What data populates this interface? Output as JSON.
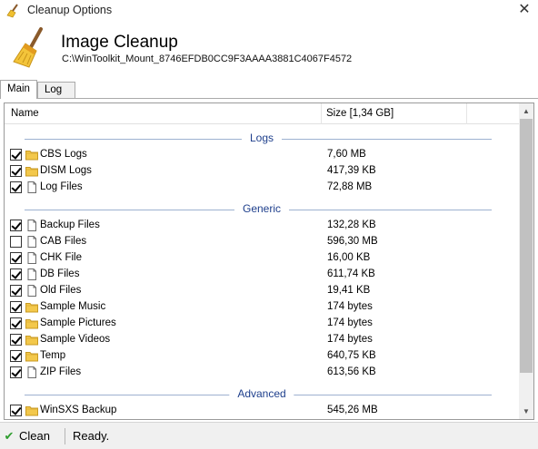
{
  "window": {
    "title": "Cleanup Options",
    "close_glyph": "✕",
    "app_icon": "broom-icon"
  },
  "header": {
    "title": "Image Cleanup",
    "path": "C:\\WinToolkit_Mount_8746EFDB0CC9F3AAAA3881C4067F4572",
    "icon": "broom-icon"
  },
  "tabs": [
    {
      "label": "Main",
      "active": true
    },
    {
      "label": "Log",
      "active": false
    }
  ],
  "columns": {
    "name": "Name",
    "size": "Size [1,34 GB]"
  },
  "groups": [
    {
      "label": "Logs"
    },
    {
      "label": "Generic"
    },
    {
      "label": "Advanced"
    }
  ],
  "rows": [
    {
      "checked": true,
      "icon": "folder-icon",
      "name": "CBS Logs",
      "size": "7,60 MB"
    },
    {
      "checked": true,
      "icon": "folder-icon",
      "name": "DISM Logs",
      "size": "417,39 KB"
    },
    {
      "checked": true,
      "icon": "file-icon",
      "name": "Log Files",
      "size": "72,88 MB"
    },
    {
      "checked": true,
      "icon": "file-icon",
      "name": "Backup Files",
      "size": "132,28 KB"
    },
    {
      "checked": false,
      "icon": "file-icon",
      "name": "CAB Files",
      "size": "596,30 MB"
    },
    {
      "checked": true,
      "icon": "file-icon",
      "name": "CHK File",
      "size": "16,00 KB"
    },
    {
      "checked": true,
      "icon": "file-icon",
      "name": "DB Files",
      "size": "611,74 KB"
    },
    {
      "checked": true,
      "icon": "file-icon",
      "name": "Old Files",
      "size": "19,41 KB"
    },
    {
      "checked": true,
      "icon": "folder-icon",
      "name": "Sample Music",
      "size": "174 bytes"
    },
    {
      "checked": true,
      "icon": "folder-icon",
      "name": "Sample Pictures",
      "size": "174 bytes"
    },
    {
      "checked": true,
      "icon": "folder-icon",
      "name": "Sample Videos",
      "size": "174 bytes"
    },
    {
      "checked": true,
      "icon": "folder-icon",
      "name": "Temp",
      "size": "640,75 KB"
    },
    {
      "checked": true,
      "icon": "file-icon",
      "name": "ZIP Files",
      "size": "613,56 KB"
    },
    {
      "checked": true,
      "icon": "folder-icon",
      "name": "WinSXS Backup",
      "size": "545,26 MB"
    }
  ],
  "statusbar": {
    "clean_label": "Clean",
    "status": "Ready."
  },
  "colors": {
    "group_text": "#1e3f8c",
    "group_line": "#9db1d0",
    "folder": "#f3c84b",
    "check_green": "#2f9e2f"
  }
}
